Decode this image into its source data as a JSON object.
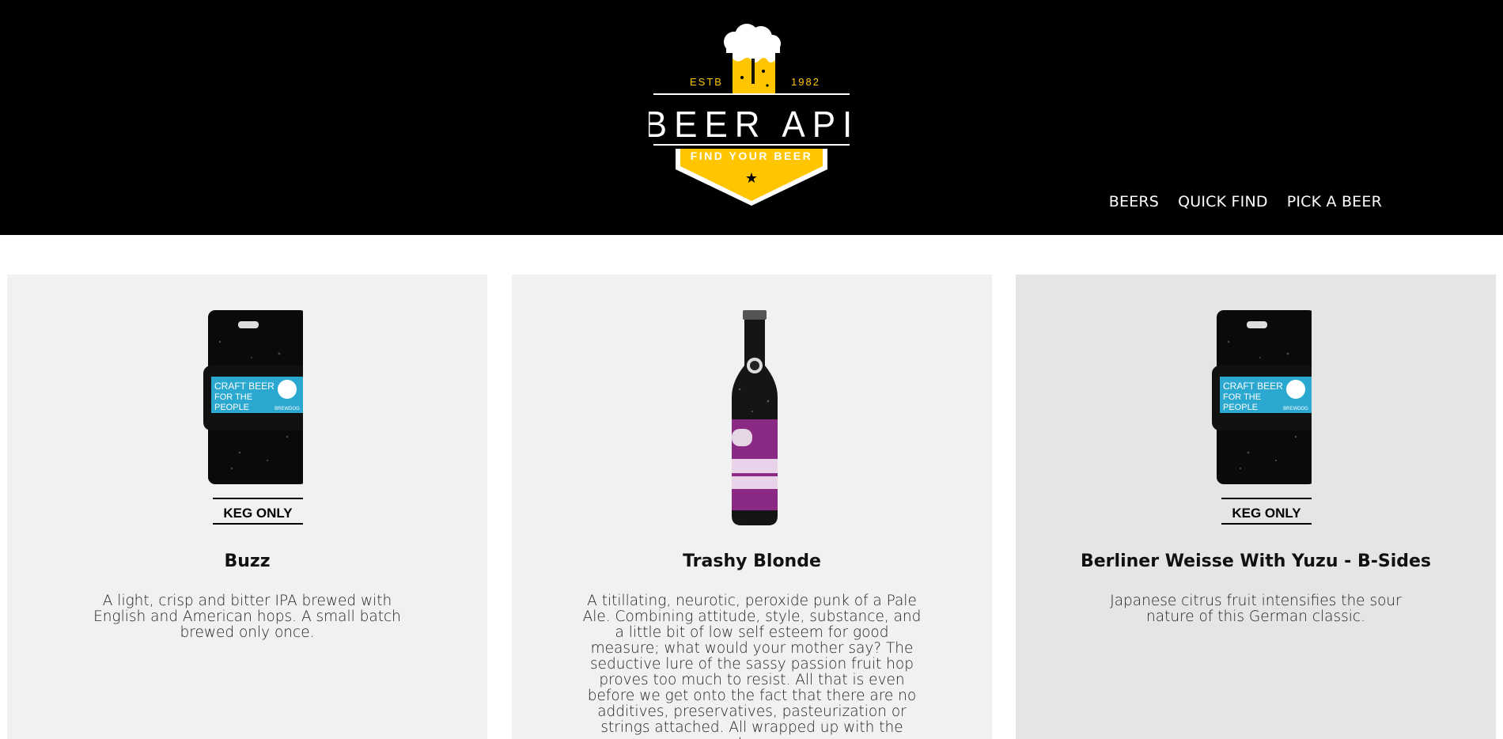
{
  "logo": {
    "estb_left": "ESTB",
    "estb_right": "1982",
    "title": "BEER API",
    "tagline": "FIND YOUR BEER",
    "colors": {
      "gold": "#ffc600",
      "white": "#ffffff",
      "black": "#000000"
    }
  },
  "nav": {
    "items": [
      {
        "label": "BEERS"
      },
      {
        "label": "QUICK FIND"
      },
      {
        "label": "PICK A BEER"
      }
    ]
  },
  "cards": [
    {
      "name": "Buzz",
      "image_type": "keg-icon",
      "badge": "KEG ONLY",
      "keg_label": [
        "CRAFT BEER",
        "FOR THE",
        "PEOPLE"
      ],
      "keg_brand": "BREWDOG",
      "description": "A light, crisp and bitter IPA brewed with English and American hops. A small batch brewed only once."
    },
    {
      "name": "Trashy Blonde",
      "image_type": "bottle-icon",
      "description": "A titillating, neurotic, peroxide punk of a Pale Ale. Combining attitude, style, substance, and a little bit of low self esteem for good measure; what would your mother say? The seductive lure of the sassy passion fruit hop proves too much to resist. All that is even before we get onto the fact that there are no additives, preservatives, pasteurization or strings attached. All wrapped up with the customary"
    },
    {
      "name": "Berliner Weisse With Yuzu - B-Sides",
      "image_type": "keg-icon",
      "badge": "KEG ONLY",
      "keg_label": [
        "CRAFT BEER",
        "FOR THE",
        "PEOPLE"
      ],
      "keg_brand": "BREWDOG",
      "description": "Japanese citrus fruit intensifies the sour nature of this German classic."
    }
  ]
}
